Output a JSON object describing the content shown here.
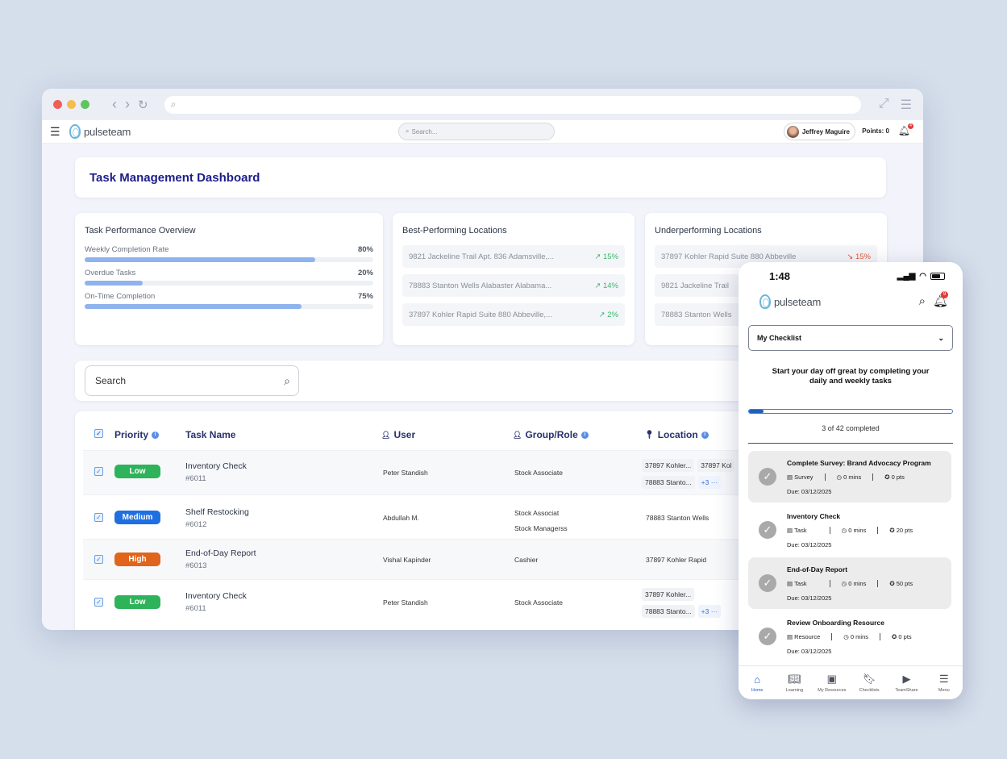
{
  "browser": {
    "url": "",
    "colors": {
      "red": "#ef5f57",
      "yellow": "#f4bd4f",
      "green": "#5fc55d"
    }
  },
  "app": {
    "logo": "pulseteam",
    "search_placeholder": "Search...",
    "user_name": "Jeffrey Maguire",
    "points_label": "Points: 0",
    "notification_count": "4"
  },
  "dashboard": {
    "title": "Task Management Dashboard"
  },
  "performance": {
    "title": "Task Performance Overview",
    "metrics": [
      {
        "label": "Weekly Completion Rate",
        "value": "80%",
        "fraction": 0.8
      },
      {
        "label": "Overdue Tasks",
        "value": "20%",
        "fraction": 0.2
      },
      {
        "label": "On-Time Completion",
        "value": "75%",
        "fraction": 0.75
      }
    ]
  },
  "best_locations": {
    "title": "Best-Performing Locations",
    "items": [
      {
        "address": "9821 Jackeline Trail Apt. 836 Adamsville,...",
        "trend": "↗ 15%"
      },
      {
        "address": "78883 Stanton Wells Alabaster Alabama...",
        "trend": "↗ 14%"
      },
      {
        "address": "37897 Kohler Rapid Suite 880 Abbeville,...",
        "trend": "↗ 2%"
      }
    ]
  },
  "under_locations": {
    "title": "Underperforming Locations",
    "items": [
      {
        "address": "37897 Kohler Rapid Suite 880 Abbeville",
        "trend": "↘ 15%"
      },
      {
        "address": "9821 Jackeline Trail",
        "trend": ""
      },
      {
        "address": "78883 Stanton Wells",
        "trend": ""
      }
    ]
  },
  "search": {
    "placeholder": "Search"
  },
  "table": {
    "headers": {
      "priority": "Priority",
      "task_name": "Task Name",
      "user": "User",
      "group_role": "Group/Role",
      "location": "Location"
    },
    "rows": [
      {
        "priority": "Low",
        "priority_color": "#2eb35a",
        "name": "Inventory Check",
        "id": "#6011",
        "user": "Peter Standish",
        "groups": [
          "Stock Associate"
        ],
        "locations": [
          "37897 Kohler...",
          "37897 Kol",
          "78883 Stanto..."
        ],
        "more": "+3 ···"
      },
      {
        "priority": "Medium",
        "priority_color": "#1f6fe0",
        "name": "Shelf Restocking",
        "id": "#6012",
        "user": "Abdullah M.",
        "groups": [
          "Stock Associat",
          "Stock Managerss"
        ],
        "locations": [
          "78883 Stanton Wells"
        ],
        "more": ""
      },
      {
        "priority": "High",
        "priority_color": "#e0641b",
        "name": "End-of-Day Report",
        "id": "#6013",
        "user": "Vishal Kapinder",
        "groups": [
          "Cashier"
        ],
        "locations": [
          "37897 Kohler Rapid"
        ],
        "more": ""
      },
      {
        "priority": "Low",
        "priority_color": "#2eb35a",
        "name": "Inventory Check",
        "id": "#6011",
        "user": "Peter Standish",
        "groups": [
          "Stock Associate"
        ],
        "locations": [
          "37897 Kohler...",
          "78883 Stanto..."
        ],
        "more": "+3 ···"
      }
    ]
  },
  "phone": {
    "time": "1:48",
    "logo": "pulseteam",
    "notification_count": "9",
    "dropdown_value": "My Checklist",
    "motto": "Start your day off great by completing your daily and weekly tasks",
    "progress_fraction": 0.07,
    "completed_text": "3 of 42 completed",
    "items": [
      {
        "title": "Complete Survey: Brand Advocacy Program",
        "type": "Survey",
        "mins": "0 mins",
        "pts": "0 pts",
        "due": "Due: 03/12/2025",
        "gray": true
      },
      {
        "title": "Inventory Check",
        "type": "Task",
        "mins": "0 mins",
        "pts": "20 pts",
        "due": "Due: 03/12/2025",
        "gray": false
      },
      {
        "title": "End-of-Day Report",
        "type": "Task",
        "mins": "0 mins",
        "pts": "50 pts",
        "due": "Due: 03/12/2025",
        "gray": true
      },
      {
        "title": "Review Onboarding Resource",
        "type": "Resource",
        "mins": "0 mins",
        "pts": "0 pts",
        "due": "Due: 03/12/2025",
        "gray": false
      }
    ],
    "tabs": [
      {
        "label": "Home",
        "icon": "home-icon",
        "active": true
      },
      {
        "label": "Learning",
        "icon": "book-icon",
        "active": false
      },
      {
        "label": "My Resources",
        "icon": "play-stack-icon",
        "active": false
      },
      {
        "label": "Checklists",
        "icon": "bookmark-icon",
        "active": false
      },
      {
        "label": "TeamShare",
        "icon": "video-icon",
        "active": false
      },
      {
        "label": "Menu",
        "icon": "menu-icon",
        "active": false
      }
    ]
  }
}
